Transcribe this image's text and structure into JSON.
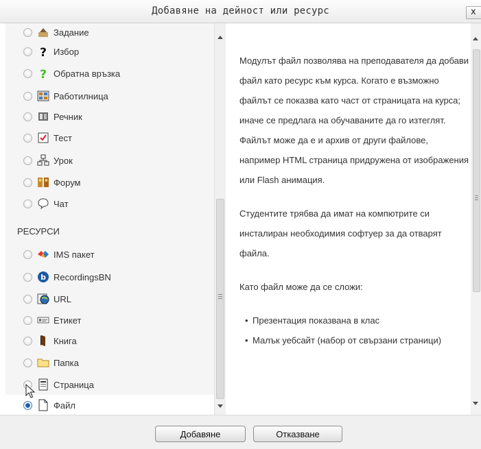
{
  "dialog": {
    "title": "Добавяне на дейност или ресурс",
    "close_label": "x"
  },
  "activities": [
    {
      "label": "Задание",
      "icon": "assignment-icon",
      "selected": false
    },
    {
      "label": "Избор",
      "icon": "choice-question-icon",
      "selected": false
    },
    {
      "label": "Обратна връзка",
      "icon": "feedback-question-icon",
      "selected": false
    },
    {
      "label": "Работилница",
      "icon": "workshop-icon",
      "selected": false
    },
    {
      "label": "Речник",
      "icon": "glossary-icon",
      "selected": false
    },
    {
      "label": "Тест",
      "icon": "quiz-icon",
      "selected": false
    },
    {
      "label": "Урок",
      "icon": "lesson-icon",
      "selected": false
    },
    {
      "label": "Форум",
      "icon": "forum-icon",
      "selected": false
    },
    {
      "label": "Чат",
      "icon": "chat-icon",
      "selected": false
    }
  ],
  "resources_heading": "РЕСУРСИ",
  "resources": [
    {
      "label": "IMS пакет",
      "icon": "ims-package-icon",
      "selected": false
    },
    {
      "label": "RecordingsBN",
      "icon": "recordings-icon",
      "selected": false
    },
    {
      "label": "URL",
      "icon": "url-globe-icon",
      "selected": false
    },
    {
      "label": "Етикет",
      "icon": "label-icon",
      "selected": false
    },
    {
      "label": "Книга",
      "icon": "book-icon",
      "selected": false
    },
    {
      "label": "Папка",
      "icon": "folder-icon",
      "selected": false
    },
    {
      "label": "Страница",
      "icon": "page-icon",
      "selected": false
    },
    {
      "label": "Файл",
      "icon": "file-icon",
      "selected": true
    }
  ],
  "description": {
    "paragraph1": "Модулът файл позволява на преподавателя да добави файл като ресурс към курса. Когато е възможно файлът се показва като част от страницата на курса; иначе се предлага на обучаваните да го изтеглят. Файлът може да е и архив от други файлове, например HTML страница придружена от изображения или Flash анимация.",
    "paragraph2": "Студентите трябва да имат на компютрите си инсталиран необходимия софтуер за да отварят файла.",
    "paragraph3": "Като файл може да се сложи:",
    "bullets": [
      "Презентация показвана в клас",
      "Малък уебсайт (набор от свързани страници)"
    ]
  },
  "buttons": {
    "add_label": "Добавяне",
    "cancel_label": "Отказване"
  },
  "colors": {
    "panel_bg": "#f5f5f5",
    "selected_bg": "#ffffff",
    "radio_checked": "#1d5aa5"
  }
}
